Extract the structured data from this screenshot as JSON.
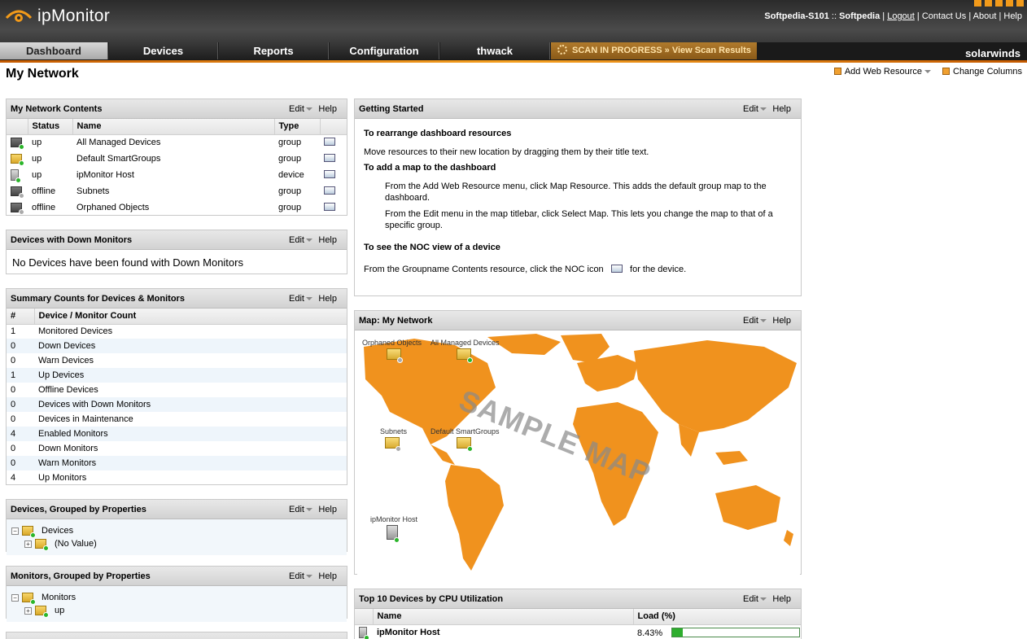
{
  "app": {
    "name": "ipMonitor"
  },
  "header": {
    "user": "Softpedia-S101",
    "separator": "::",
    "account": "Softpedia",
    "links": [
      "Logout",
      "Contact Us",
      "About",
      "Help"
    ],
    "brand": "solarwinds"
  },
  "nav": {
    "tabs": [
      "Dashboard",
      "Devices",
      "Reports",
      "Configuration",
      "thwack"
    ],
    "active": "Dashboard",
    "scan_text": "SCAN IN PROGRESS » View Scan Results"
  },
  "page": {
    "title": "My Network",
    "add_web_resource": "Add Web Resource",
    "change_columns": "Change Columns"
  },
  "common": {
    "edit": "Edit",
    "help": "Help"
  },
  "network_contents": {
    "title": "My Network Contents",
    "columns": [
      "Status",
      "Name",
      "Type"
    ],
    "rows": [
      {
        "status": "up",
        "name": "All Managed Devices",
        "type": "group",
        "icon": "folder-grey-up-icon"
      },
      {
        "status": "up",
        "name": "Default SmartGroups",
        "type": "group",
        "icon": "folder-up-icon"
      },
      {
        "status": "up",
        "name": "ipMonitor Host",
        "type": "device",
        "icon": "server-up-icon"
      },
      {
        "status": "offline",
        "name": "Subnets",
        "type": "group",
        "icon": "folder-offline-icon"
      },
      {
        "status": "offline",
        "name": "Orphaned Objects",
        "type": "group",
        "icon": "folder-offline-icon"
      }
    ]
  },
  "down_monitors": {
    "title": "Devices with Down Monitors",
    "message": "No Devices have been found with Down Monitors"
  },
  "summary": {
    "title": "Summary Counts for Devices & Monitors",
    "columns": [
      "#",
      "Device / Monitor Count"
    ],
    "rows": [
      {
        "count": "1",
        "label": "Monitored Devices"
      },
      {
        "count": "0",
        "label": "Down Devices"
      },
      {
        "count": "0",
        "label": "Warn Devices"
      },
      {
        "count": "1",
        "label": "Up Devices"
      },
      {
        "count": "0",
        "label": "Offline Devices"
      },
      {
        "count": "0",
        "label": "Devices with Down Monitors"
      },
      {
        "count": "0",
        "label": "Devices in Maintenance"
      },
      {
        "count": "4",
        "label": "Enabled Monitors"
      },
      {
        "count": "0",
        "label": "Down Monitors"
      },
      {
        "count": "0",
        "label": "Warn Monitors"
      },
      {
        "count": "4",
        "label": "Up Monitors"
      }
    ]
  },
  "devices_grouped": {
    "title": "Devices, Grouped by Properties",
    "root": "Devices",
    "child": "(No Value)"
  },
  "monitors_grouped": {
    "title": "Monitors, Grouped by Properties",
    "root": "Monitors",
    "child": "up"
  },
  "getting_started": {
    "title": "Getting Started",
    "h1": "To rearrange dashboard resources",
    "p1": "Move resources to their new location by dragging them by their title text.",
    "h2": "To add a map to the dashboard",
    "p2": "From the Add Web Resource menu, click Map Resource. This adds the default group map to the dashboard.",
    "p3": "From the Edit menu in the map titlebar, click Select Map. This lets you change the map to that of a specific group.",
    "h3": "To see the NOC view of a device",
    "p4a": "From the Groupname Contents resource, click the NOC icon",
    "p4b": "for the device."
  },
  "map": {
    "title": "Map: My Network",
    "watermark": "SAMPLE MAP",
    "nodes": [
      "Orphaned Objects",
      "All Managed Devices",
      "Subnets",
      "Default SmartGroups",
      "ipMonitor Host"
    ],
    "land_color": "#f0921e"
  },
  "cpu": {
    "title": "Top 10 Devices by CPU Utilization",
    "columns": [
      "Name",
      "Load (%)"
    ],
    "rows": [
      {
        "name": "ipMonitor Host",
        "load": "8.43%",
        "load_fraction": 0.0843
      }
    ]
  },
  "colors": {
    "accent": "#f29a1a",
    "up": "#2ab52a",
    "alt_row": "#eef5fb"
  }
}
